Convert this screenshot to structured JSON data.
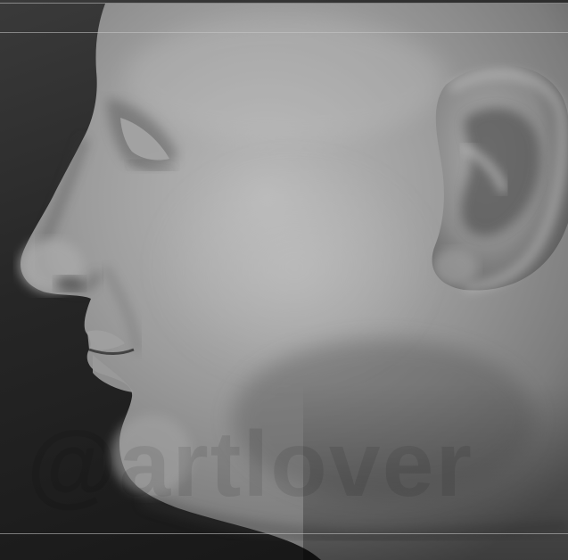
{
  "viewport": {
    "watermark": "@artlover"
  },
  "colors": {
    "background_dark": "#141414",
    "background_light": "#3a3a3a",
    "clay_light": "#b8b8b8",
    "clay_mid": "#8a8a8a",
    "clay_shadow": "#4a4a4a",
    "guide_line": "#c8c8c8"
  }
}
